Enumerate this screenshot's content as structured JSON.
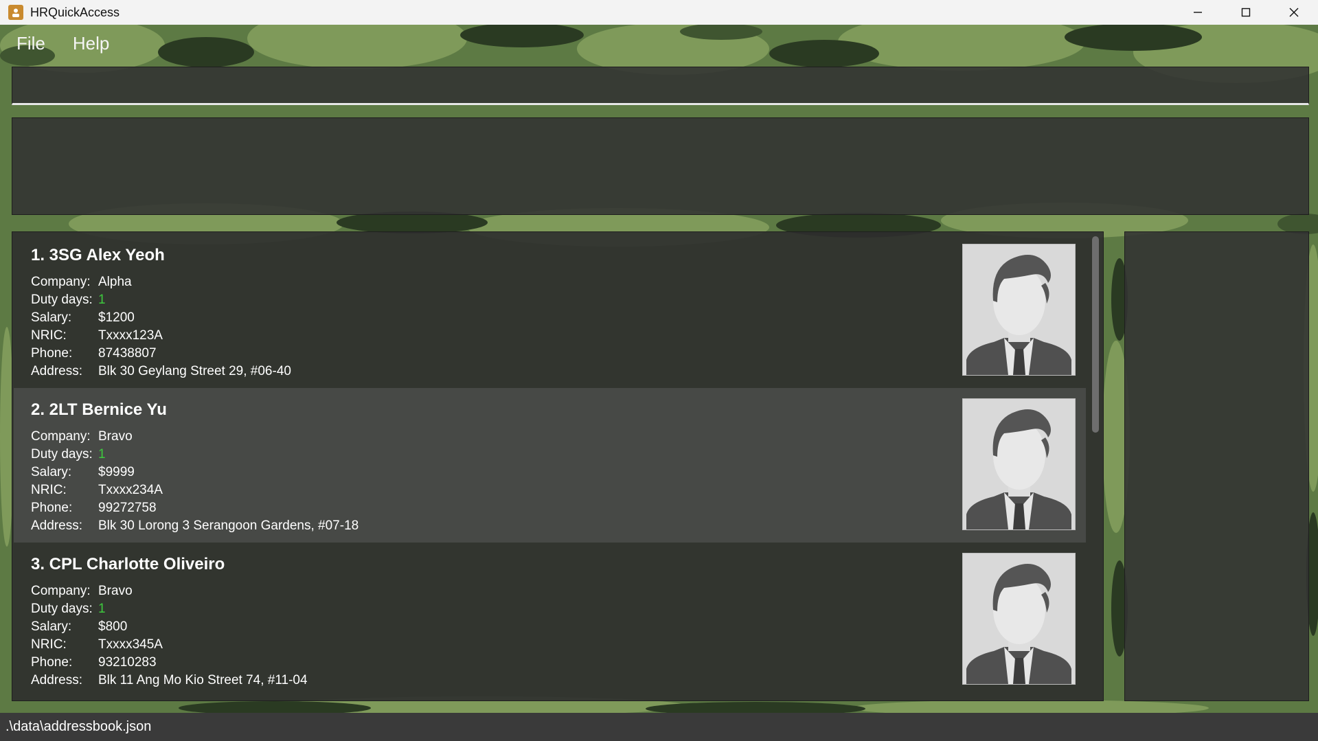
{
  "window": {
    "title": "HRQuickAccess",
    "app_icon": "person-icon",
    "controls": {
      "minimize": "—",
      "maximize": "☐",
      "close": "✕"
    }
  },
  "menu": {
    "items": [
      {
        "label": "File"
      },
      {
        "label": "Help"
      }
    ]
  },
  "command_box": {
    "value": "",
    "placeholder": ""
  },
  "result_display": {
    "text": ""
  },
  "person_list": {
    "labels": {
      "company": "Company:",
      "duty_days": "Duty days:",
      "salary": "Salary:",
      "nric": "NRIC:",
      "phone": "Phone:",
      "address": "Address:"
    },
    "persons": [
      {
        "header": "1. 3SG Alex Yeoh",
        "company": "Alpha",
        "duty_days": "1",
        "salary": "$1200",
        "nric": "Txxxx123A",
        "phone": "87438807",
        "address": "Blk 30 Geylang Street 29, #06-40"
      },
      {
        "header": "2. 2LT Bernice Yu",
        "company": "Bravo",
        "duty_days": "1",
        "salary": "$9999",
        "nric": "Txxxx234A",
        "phone": "99272758",
        "address": "Blk 30 Lorong 3 Serangoon Gardens, #07-18"
      },
      {
        "header": "3. CPL Charlotte Oliveiro",
        "company": "Bravo",
        "duty_days": "1",
        "salary": "$800",
        "nric": "Txxxx345A",
        "phone": "93210283",
        "address": "Blk 11 Ang Mo Kio Street 74, #11-04"
      }
    ]
  },
  "status_bar": {
    "path": ".\\data\\addressbook.json"
  },
  "colors": {
    "duty_days_value": "#3ec93e",
    "panel_bg": "#323232",
    "camo_base": "#5d7a44",
    "camo_dark": "#2a3a22",
    "camo_light": "#7f9a5a"
  }
}
